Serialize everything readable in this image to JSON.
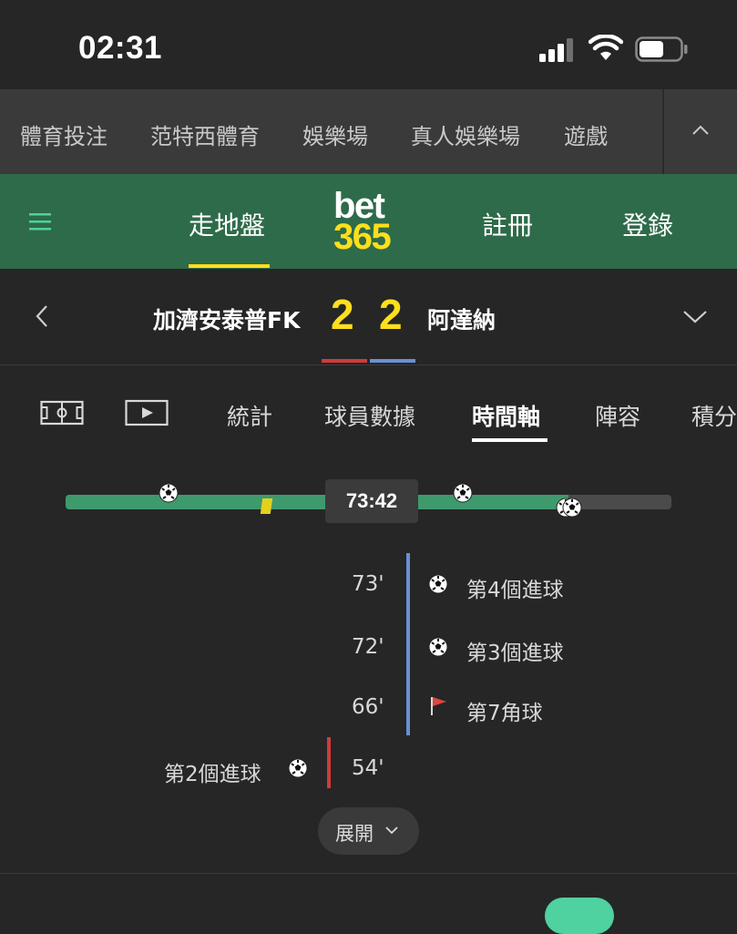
{
  "status_bar": {
    "time": "02:31"
  },
  "category_nav": {
    "items": [
      {
        "label": "體育投注"
      },
      {
        "label": "范特西體育"
      },
      {
        "label": "娛樂場"
      },
      {
        "label": "真人娛樂場"
      },
      {
        "label": "遊戲"
      }
    ]
  },
  "header": {
    "tabs": [
      {
        "label": "走地盤",
        "active": true
      },
      {
        "label": "註冊"
      },
      {
        "label": "登錄"
      }
    ],
    "logo": {
      "line1": "bet",
      "line2": "365"
    },
    "colors": {
      "background": "#2e6b4a",
      "accent": "#ffdf1b",
      "menu_icon": "#4fd1a0"
    }
  },
  "match": {
    "home_team": "加濟安泰普FK",
    "home_score": "2",
    "away_team": "阿達納",
    "away_score": "2",
    "home_color": "#d23a3a",
    "away_color": "#6b8fd6"
  },
  "tabs": {
    "icons": [
      "pitch-icon",
      "video-icon"
    ],
    "items": [
      {
        "label": "統計"
      },
      {
        "label": "球員數據"
      },
      {
        "label": "時間軸",
        "active": true
      },
      {
        "label": "陣容"
      },
      {
        "label": "積分"
      }
    ]
  },
  "progress": {
    "clock": "73:42",
    "elapsed_fraction": 0.83
  },
  "timeline": {
    "events": [
      {
        "minute": "73'",
        "text": "第4個進球",
        "side": "away",
        "icon": "ball-icon"
      },
      {
        "minute": "72'",
        "text": "第3個進球",
        "side": "away",
        "icon": "ball-icon"
      },
      {
        "minute": "66'",
        "text": "第7角球",
        "side": "away",
        "icon": "corner-flag-icon"
      },
      {
        "minute": "54'",
        "text": "第2個進球",
        "side": "home",
        "icon": "ball-icon"
      }
    ],
    "expand_label": "展開"
  }
}
